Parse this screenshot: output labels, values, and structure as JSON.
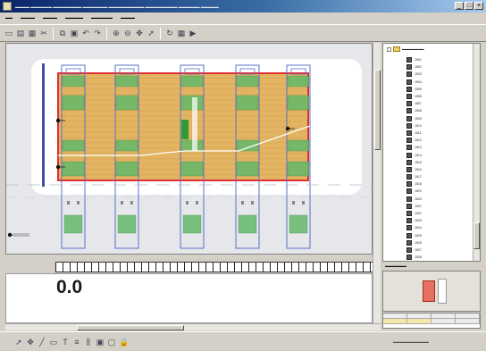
{
  "readout": {
    "value": "0.0"
  },
  "tree": {
    "items": [
      {
        "label": "1501"
      },
      {
        "label": "1502"
      },
      {
        "label": "1503"
      },
      {
        "label": "1504"
      },
      {
        "label": "1505"
      },
      {
        "label": "1506"
      },
      {
        "label": "1507"
      },
      {
        "label": "1508"
      },
      {
        "label": "1509"
      },
      {
        "label": "1510"
      },
      {
        "label": "1511"
      },
      {
        "label": "1512"
      },
      {
        "label": "1513"
      },
      {
        "label": "1514"
      },
      {
        "label": "1515"
      },
      {
        "label": "1516"
      },
      {
        "label": "1517"
      },
      {
        "label": "1518"
      },
      {
        "label": "1519"
      },
      {
        "label": "1520"
      },
      {
        "label": "1521"
      },
      {
        "label": "1522"
      },
      {
        "label": "1523"
      },
      {
        "label": "1524"
      },
      {
        "label": "1525"
      },
      {
        "label": "1526"
      },
      {
        "label": "1527"
      },
      {
        "label": "1528"
      },
      {
        "label": "1529"
      }
    ]
  },
  "icons": {
    "toolbar": [
      "new-icon",
      "open-icon",
      "save-icon",
      "cut-icon",
      "copy-icon",
      "paste-icon",
      "undo-icon",
      "redo-icon",
      "zoom-in-icon",
      "zoom-out-icon",
      "pan-icon",
      "select-icon",
      "rotate-icon",
      "grid-icon",
      "play-icon"
    ],
    "statusbar": [
      "pointer-icon",
      "move-icon",
      "line-icon",
      "rect-icon",
      "text-icon",
      "align-icon",
      "distribute-icon",
      "group-icon",
      "ungroup-icon",
      "lock-icon"
    ]
  },
  "colors": {
    "floor": "#e3b462",
    "module_green": "#63b96a",
    "outline_blue": "#5a6fc8",
    "highlight_red": "#e23030"
  }
}
